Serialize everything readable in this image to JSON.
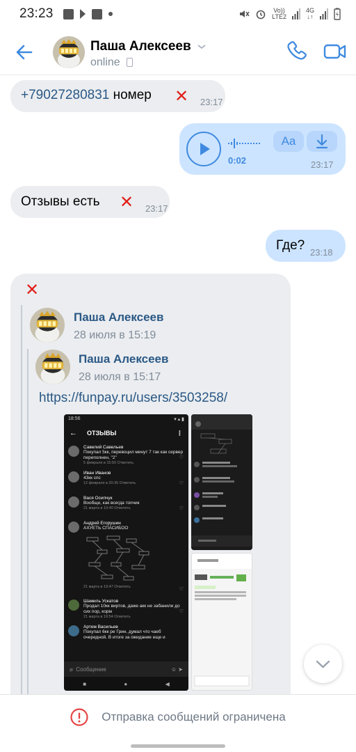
{
  "status_bar": {
    "time": "23:23",
    "network_top": "Vo))",
    "network_bottom": "LTE2",
    "gen_top": "4G",
    "gen_bottom": "↓↑"
  },
  "header": {
    "contact_name": "Паша Алексеев",
    "status": "online"
  },
  "colors": {
    "accent": "#3f8ae0",
    "incoming_bubble": "#ebedf0",
    "outgoing_bubble": "#cce4ff",
    "link": "#2a5885",
    "warning": "#e64646"
  },
  "messages": [
    {
      "direction": "in",
      "link": "+79027280831",
      "text": " номер",
      "mark": "✕",
      "time": "23:17"
    },
    {
      "direction": "out",
      "type": "voice",
      "duration": "0:02",
      "transcribe_label": "Aa",
      "time": "23:17"
    },
    {
      "direction": "in",
      "text": "Отзывы есть",
      "mark": "✕",
      "time": "23:17"
    },
    {
      "direction": "out",
      "text": "Где?",
      "time": "23:18"
    },
    {
      "direction": "in",
      "mark": "✕",
      "forward_outer": {
        "name": "Паша Алексеев",
        "date": "28 июля в 15:19"
      },
      "forward_inner": {
        "name": "Паша Алексеев",
        "date": "28 июля в 15:17",
        "link": "https://funpay.ru/users/3503258/"
      },
      "photo": {
        "time": "18:56",
        "title": "ОТЗЫВЫ",
        "reviews": [
          {
            "name": "Савелий Савельев",
            "text": "Покупал 5кк, перевоцил минут 7 так как сервер переполнен, \"2\"",
            "meta": "5 февраля в 15:50   Ответить"
          },
          {
            "name": "Иван Иванов",
            "text": "43кк спс",
            "meta": "12 февраля в 20:35   Ответить"
          },
          {
            "name": "Вася Осипчук",
            "text": "Вообще, как всегда топчик",
            "meta": "21 марта в 10:40   Ответить"
          },
          {
            "name": "Андрей Егорушин",
            "text": "АХУЕТЬ СПАСИБОО",
            "meta": "21 марта в 19:47   Ответить"
          },
          {
            "name": "Шамиль Ускатов",
            "text": "Продал 10кк виртов, даже акк не забанили до сих пор, корм",
            "meta": "21 марта в 19:54   Ответить"
          },
          {
            "name": "Артем Васильев",
            "text": "Покупал 6кк ре Грин, думал что чаеб очередной. В итоге за ожидание еще и",
            "meta": ""
          }
        ],
        "input_placeholder": "Сообщение"
      }
    }
  ],
  "footer": {
    "restriction_text": "Отправка сообщений ограничена"
  }
}
